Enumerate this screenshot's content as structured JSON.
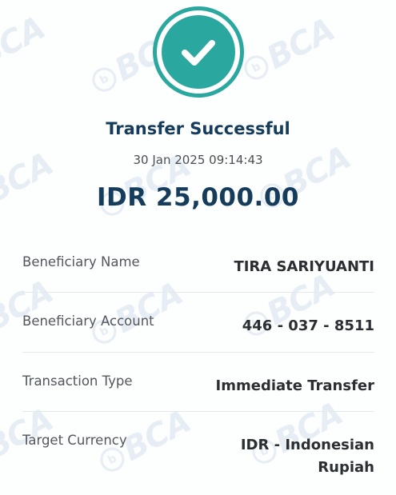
{
  "status": {
    "title": "Transfer Successful",
    "datetime": "30 Jan 2025 09:14:43",
    "amount": "IDR 25,000.00",
    "icon": "check-icon",
    "accent_color": "#2aa8a0"
  },
  "details": [
    {
      "label": "Beneficiary Name",
      "value": "TIRA SARIYUANTI"
    },
    {
      "label": "Beneficiary Account",
      "value": "446 - 037 - 8511"
    },
    {
      "label": "Transaction Type",
      "value": "Immediate Transfer"
    },
    {
      "label": "Target Currency",
      "value": "IDR - Indonesian Rupiah"
    }
  ],
  "watermark": {
    "text": "BCA",
    "color": "#2b5fa8"
  }
}
